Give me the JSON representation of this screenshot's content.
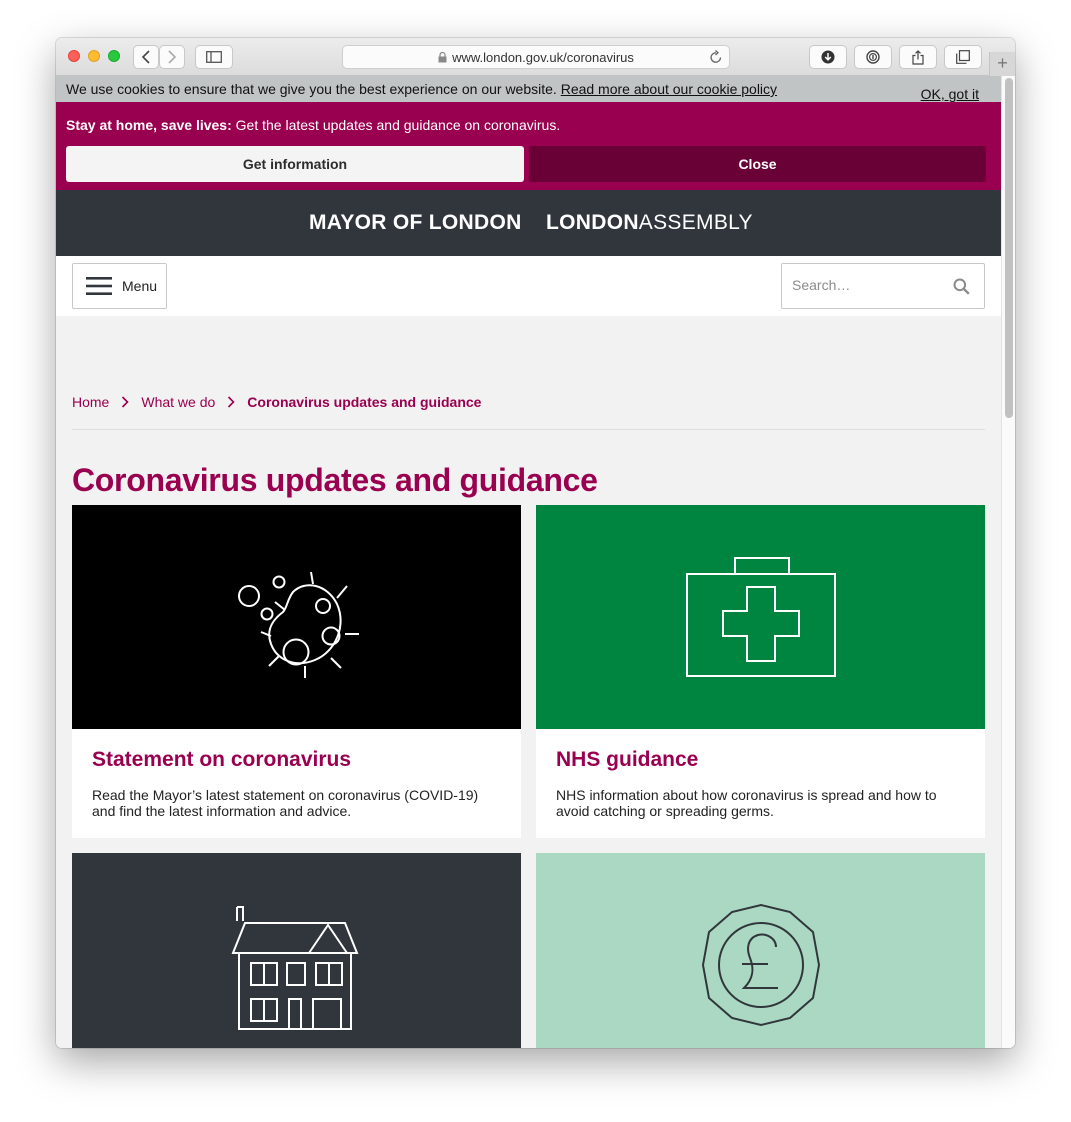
{
  "browser": {
    "url": "www.london.gov.uk/coronavirus"
  },
  "cookie_banner": {
    "message": "We use cookies to ensure that we give you the best experience on our website.",
    "link_text": "Read more about our cookie policy",
    "ok_label": "OK, got it"
  },
  "alert": {
    "bold_text": "Stay at home, save lives:",
    "text": " Get the latest updates and guidance on coronavirus.",
    "get_info_label": "Get information",
    "close_label": "Close",
    "colors": {
      "background": "#9a0050",
      "close_button": "#690036"
    }
  },
  "brand": {
    "mayor": "MAYOR OF LONDON",
    "assembly_bold": "LONDON",
    "assembly_light": "ASSEMBLY"
  },
  "nav": {
    "menu_label": "Menu",
    "search_placeholder": "Search…"
  },
  "breadcrumb": [
    "Home",
    "What we do",
    "Coronavirus updates and guidance"
  ],
  "page": {
    "title": "Coronavirus updates and guidance",
    "accent_color": "#9a0050"
  },
  "cards": [
    {
      "title": "Statement on coronavirus",
      "description": "Read the Mayor’s latest statement on coronavirus (COVID-19) and find the latest information and advice.",
      "icon": "virus-icon",
      "bg": "#000000"
    },
    {
      "title": "NHS guidance",
      "description": "NHS information about how coronavirus is spread and how to avoid catching or spreading germs.",
      "icon": "medical-kit-icon",
      "bg": "#008540"
    },
    {
      "icon": "house-icon",
      "bg": "#30363b"
    },
    {
      "icon": "pound-coin-icon",
      "bg": "#aad8c2"
    }
  ]
}
